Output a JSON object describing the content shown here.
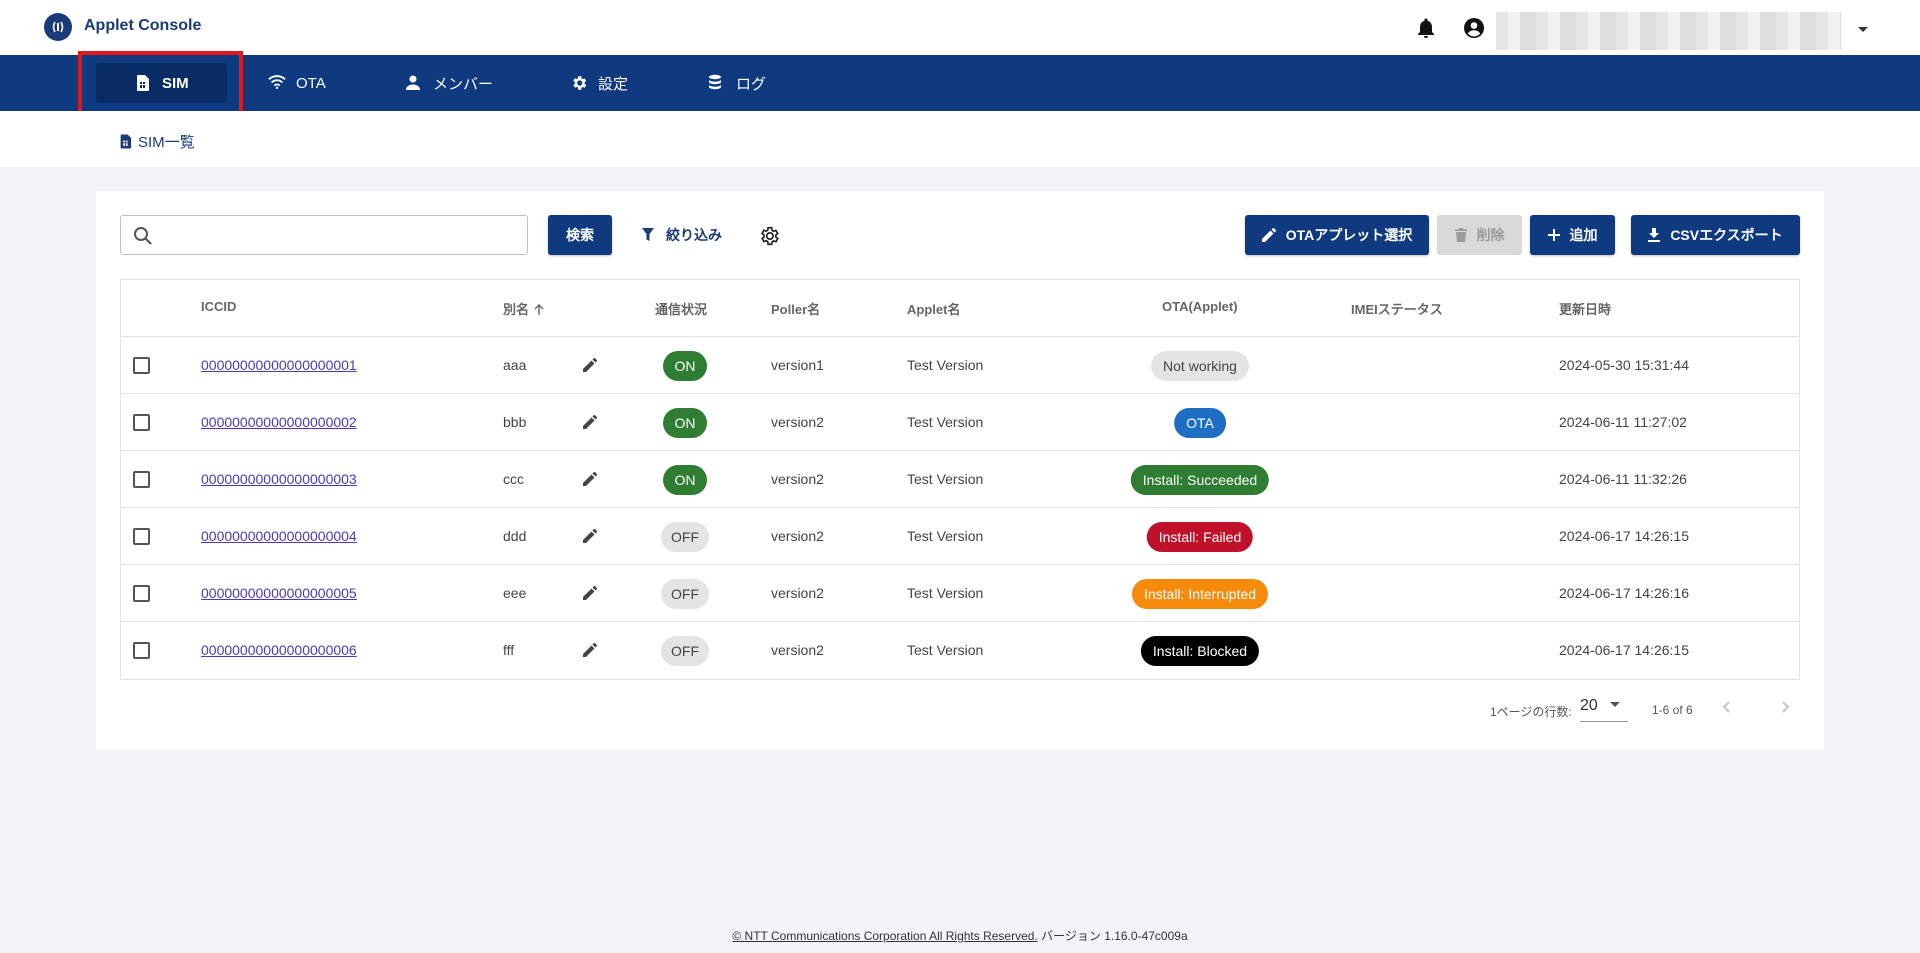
{
  "header": {
    "app_title": "Applet Console",
    "icons": [
      "broadcast-icon",
      "bell-icon",
      "account-circle-icon",
      "caret-down-icon"
    ]
  },
  "nav": {
    "items": [
      {
        "label": "SIM",
        "icon": "sim-card-icon",
        "active": true
      },
      {
        "label": "OTA",
        "icon": "wifi-icon"
      },
      {
        "label": "メンバー",
        "icon": "person-icon"
      },
      {
        "label": "設定",
        "icon": "gear-icon"
      },
      {
        "label": "ログ",
        "icon": "database-icon"
      }
    ]
  },
  "breadcrumb": {
    "label": "SIM一覧",
    "icon": "sim-card-icon"
  },
  "toolbar": {
    "search_placeholder": "",
    "search_button": "検索",
    "filter_label": "絞り込み",
    "ota_select_button": "OTAアプレット選択",
    "delete_button": "削除",
    "add_button": "追加",
    "csv_export_button": "CSVエクスポート"
  },
  "table": {
    "headers": {
      "iccid": "ICCID",
      "alias": "別名",
      "status": "通信状況",
      "poller": "Poller名",
      "applet": "Applet名",
      "ota": "OTA(Applet)",
      "imei": "IMEIステータス",
      "updated": "更新日時"
    },
    "rows": [
      {
        "iccid": "00000000000000000001",
        "alias": "aaa",
        "status": "ON",
        "poller": "version1",
        "applet": "Test Version",
        "ota": "Not working",
        "ota_bg": "#e4e4e4",
        "ota_fg": "#444444",
        "updated": "2024-05-30 15:31:44"
      },
      {
        "iccid": "00000000000000000002",
        "alias": "bbb",
        "status": "ON",
        "poller": "version2",
        "applet": "Test Version",
        "ota": "OTA",
        "ota_bg": "#1e6fc4",
        "ota_fg": "#ffffff",
        "updated": "2024-06-11 11:27:02"
      },
      {
        "iccid": "00000000000000000003",
        "alias": "ccc",
        "status": "ON",
        "poller": "version2",
        "applet": "Test Version",
        "ota": "Install: Succeeded",
        "ota_bg": "#2e7d32",
        "ota_fg": "#ffffff",
        "updated": "2024-06-11 11:32:26"
      },
      {
        "iccid": "00000000000000000004",
        "alias": "ddd",
        "status": "OFF",
        "poller": "version2",
        "applet": "Test Version",
        "ota": "Install: Failed",
        "ota_bg": "#c0102a",
        "ota_fg": "#ffffff",
        "updated": "2024-06-17 14:26:15"
      },
      {
        "iccid": "00000000000000000005",
        "alias": "eee",
        "status": "OFF",
        "poller": "version2",
        "applet": "Test Version",
        "ota": "Install: Interrupted",
        "ota_bg": "#f58a0b",
        "ota_fg": "#ffffff",
        "updated": "2024-06-17 14:26:16"
      },
      {
        "iccid": "00000000000000000006",
        "alias": "fff",
        "status": "OFF",
        "poller": "version2",
        "applet": "Test Version",
        "ota": "Install: Blocked",
        "ota_bg": "#000000",
        "ota_fg": "#ffffff",
        "updated": "2024-06-17 14:26:15"
      }
    ]
  },
  "pagination": {
    "rows_per_page_label": "1ページの行数:",
    "rows_per_page": "20",
    "range": "1-6 of 6"
  },
  "footer": {
    "copyright": "© NTT Communications Corporation All Rights Reserved.",
    "version": "バージョン 1.16.0-47c009a"
  },
  "colors": {
    "brand": "#0f3a80",
    "highlight": "#e0191d"
  }
}
